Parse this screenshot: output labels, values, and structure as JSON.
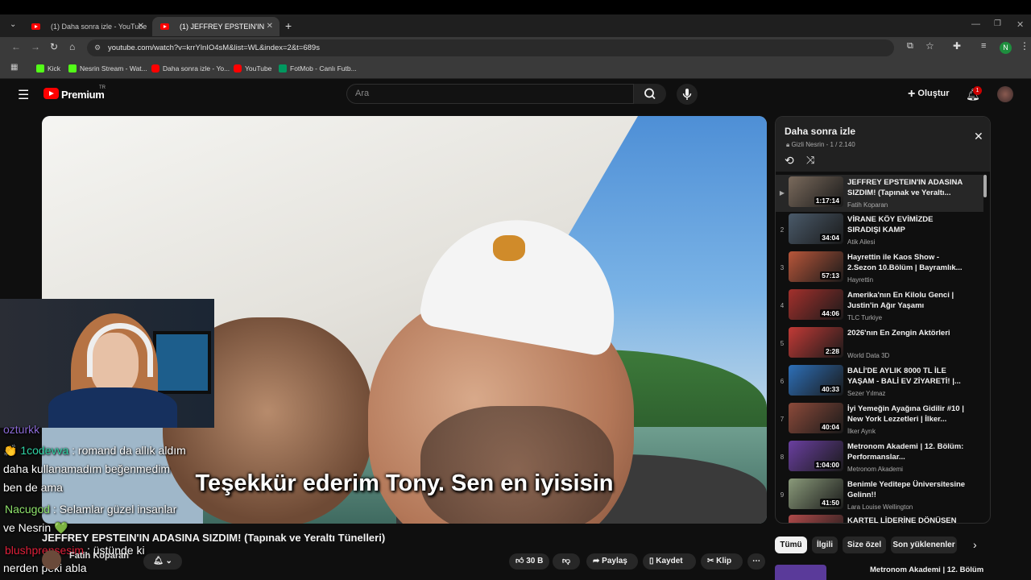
{
  "browser": {
    "tabs": [
      {
        "label": "(1) Daha sonra izle - YouTube",
        "active": false
      },
      {
        "label": "(1) JEFFREY EPSTEIN'IN ADASIN",
        "active": true
      }
    ],
    "url": "youtube.com/watch?v=krrYlnIO4sM&list=WL&index=2&t=689s",
    "profile_initial": "N",
    "bookmarks": [
      {
        "label": "Kick",
        "color": "#53fc18"
      },
      {
        "label": "Nesrin Stream - Wat...",
        "color": "#53fc18"
      },
      {
        "label": "Daha sonra izle - Yo...",
        "color": "#ff0000"
      },
      {
        "label": "YouTube",
        "color": "#ff0000"
      },
      {
        "label": "FotMob - Canlı Futb...",
        "color": "#00985f"
      }
    ]
  },
  "header": {
    "logo_text": "Premium",
    "region": "TR",
    "search_placeholder": "Ara",
    "create_label": "Oluştur",
    "notif_count": "1"
  },
  "player": {
    "subtitle": "Teşekkür ederim Tony. Sen en iyisisin"
  },
  "chat": {
    "partial_top": "ozturkk",
    "messages": [
      {
        "user": "1codevva",
        "user_color": "#2fd3a5",
        "badge": "👏",
        "lines": [
          " : romand da allık aldım",
          "daha kullanamadım beğenmedim",
          "ben de ama"
        ]
      },
      {
        "user": "Nacugod",
        "user_color": "#8fe36b",
        "badge": "",
        "lines": [
          " : Selamlar güzel insanlar",
          "ve Nesrin 💚"
        ]
      },
      {
        "user": "blushprensesim",
        "user_color": "#e0203a",
        "badge": "",
        "lines": [
          " : üstünde ki",
          "nerden peki abla"
        ]
      }
    ]
  },
  "video": {
    "title": "JEFFREY EPSTEIN'IN ADASINA SIZDIM! (Tapınak ve Yeraltı Tünelleri)",
    "channel": "Fatih Koparan",
    "likes": "30 B",
    "share_label": "Paylaş",
    "save_label": "Kaydet",
    "clip_label": "Klip"
  },
  "playlist": {
    "title": "Daha sonra izle",
    "meta": "Gizli Nesrin - 1 / 2.140",
    "items": [
      {
        "num": "▶",
        "title": "JEFFREY EPSTEIN'IN ADASINA SIZDIM! (Tapınak ve Yeraltı...",
        "channel": "Fatih Koparan",
        "duration": "1:17:14",
        "color": "#7a6a5c",
        "now": true
      },
      {
        "num": "2",
        "title": "VİRANE KÖY EVİMİZDE SIRADIŞI KAMP",
        "channel": "Atik Ailesi",
        "duration": "34:04",
        "color": "#4a5a6a",
        "now": false
      },
      {
        "num": "3",
        "title": "Hayrettin ile Kaos Show - 2.Sezon 10.Bölüm | Bayramlık...",
        "channel": "Hayrettin",
        "duration": "57:13",
        "color": "#b8563a",
        "now": false
      },
      {
        "num": "4",
        "title": "Amerika'nın En Kilolu Genci | Justin'in Ağır Yaşamı",
        "channel": "TLC Turkiye",
        "duration": "44:06",
        "color": "#a3302c",
        "now": false
      },
      {
        "num": "5",
        "title": "2026'nın En Zengin Aktörleri",
        "channel": "World Data 3D",
        "duration": "2:28",
        "color": "#c23a36",
        "now": false
      },
      {
        "num": "6",
        "title": "BALİ'DE AYLIK 8000 TL İLE YAŞAM - BALİ EV ZİYARETİ! |...",
        "channel": "Sezer Yılmaz",
        "duration": "40:33",
        "color": "#2d6fb8",
        "now": false
      },
      {
        "num": "7",
        "title": "İyi Yemeğin Ayağına Gidilir #10 | New York Lezzetleri | İlker...",
        "channel": "İlker Ayrık",
        "duration": "40:04",
        "color": "#8c4a3a",
        "now": false
      },
      {
        "num": "8",
        "title": "Metronom Akademi | 12. Bölüm: Performanslar...",
        "channel": "Metronom Akademi",
        "duration": "1:04:00",
        "color": "#6a3fa0",
        "now": false
      },
      {
        "num": "9",
        "title": "Benimle Yeditepe Üniversitesine Gelinn!!",
        "channel": "Lara Louise Wellington",
        "duration": "41:50",
        "color": "#8a9a7a",
        "now": false
      },
      {
        "num": "",
        "title": "KARTEL LİDERİNE DÖNÜŞEN",
        "channel": "",
        "duration": "",
        "color": "#b04a4a",
        "now": false
      }
    ]
  },
  "chips": [
    {
      "label": "Tümü",
      "selected": true
    },
    {
      "label": "İlgili",
      "selected": false
    },
    {
      "label": "Size özel",
      "selected": false
    },
    {
      "label": "Son yüklenenler",
      "selected": false
    }
  ],
  "peek_title": "Metronom Akademi | 12. Bölüm"
}
